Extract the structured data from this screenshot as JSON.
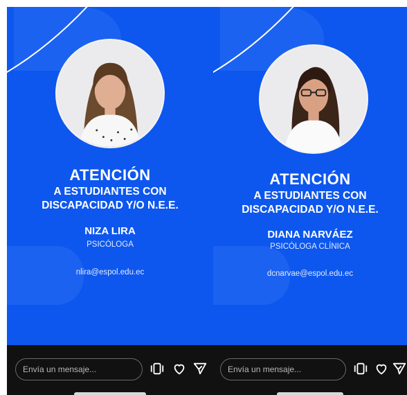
{
  "stories": [
    {
      "title_line1": "ATENCIÓN",
      "title_line2": "A ESTUDIANTES CON",
      "title_line3": "DISCAPACIDAD Y/O N.E.E.",
      "name": "NIZA LIRA",
      "role": "PSICÓLOGA",
      "email": "nlira@espol.edu.ec",
      "message_placeholder": "Envía un mensaje..."
    },
    {
      "title_line1": "ATENCIÓN",
      "title_line2": "A ESTUDIANTES CON",
      "title_line3": "DISCAPACIDAD Y/O N.E.E.",
      "name": "DIANA NARVÁEZ",
      "role": "PSICÓLOGA CLÍNICA",
      "email": "dcnarvae@espol.edu.ec",
      "message_placeholder": "Envía un mensaje..."
    }
  ],
  "colors": {
    "story_background": "#0d57ee",
    "story_accent": "#2a6cf4",
    "bottom_bar": "#111111",
    "text": "#ffffff"
  },
  "icons": [
    "sticker-icon",
    "heart-icon",
    "send-icon"
  ]
}
